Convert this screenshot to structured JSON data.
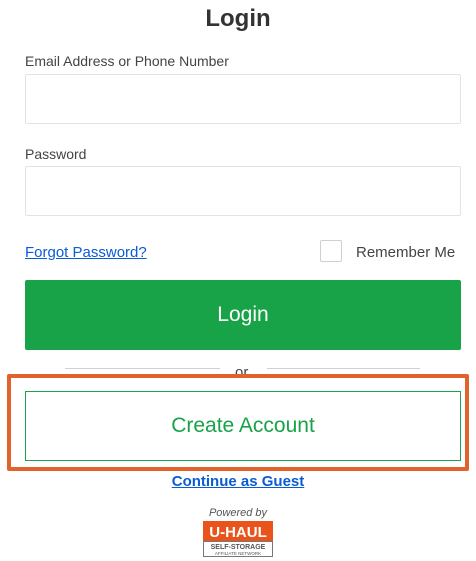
{
  "form": {
    "title": "Login",
    "email_label": "Email Address or Phone Number",
    "email_value": "",
    "password_label": "Password",
    "password_value": "",
    "forgot_password": "Forgot Password?",
    "remember_me": "Remember Me",
    "remember_checked": false,
    "login_button": "Login",
    "or_text": "or",
    "create_account": "Create Account",
    "continue_guest": "Continue as Guest"
  },
  "footer": {
    "powered_by": "Powered by",
    "logo": {
      "brand": "U-HAUL",
      "line1": "SELF-STORAGE",
      "line2": "AFFILIATE NETWORK"
    }
  },
  "colors": {
    "primary_green": "#18a349",
    "link_blue": "#0a5bd6",
    "highlight_orange": "#e2622c",
    "logo_orange": "#e8541c"
  },
  "icons": {
    "logo": "uhaul-logo"
  }
}
